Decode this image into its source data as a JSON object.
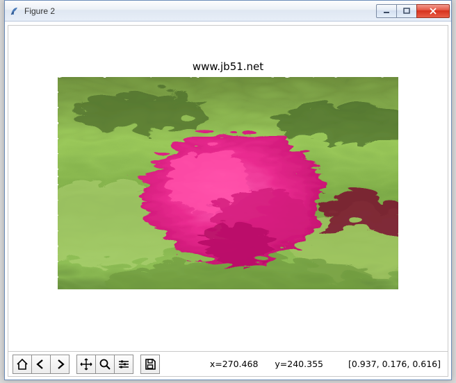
{
  "window": {
    "title": "Figure 2",
    "controls": {
      "minimize": "minimize",
      "maximize": "maximize",
      "close": "close"
    }
  },
  "plot": {
    "title": "www.jb51.net"
  },
  "toolbar": {
    "buttons": {
      "home": "home-icon",
      "back": "back-icon",
      "forward": "forward-icon",
      "pan": "pan-icon",
      "zoom": "zoom-icon",
      "subplots": "subplots-icon",
      "save": "save-icon"
    }
  },
  "status": {
    "x_label": "x=",
    "x_value": "270.468",
    "y_label": "y=",
    "y_value": "240.355",
    "rgb": "[0.937, 0.176, 0.616]"
  },
  "colors": {
    "accent": "#e7eef8",
    "close": "#d6311d",
    "flower": "#e82c8f",
    "green_light": "#8abf4a",
    "green_dark": "#3a6a28"
  }
}
